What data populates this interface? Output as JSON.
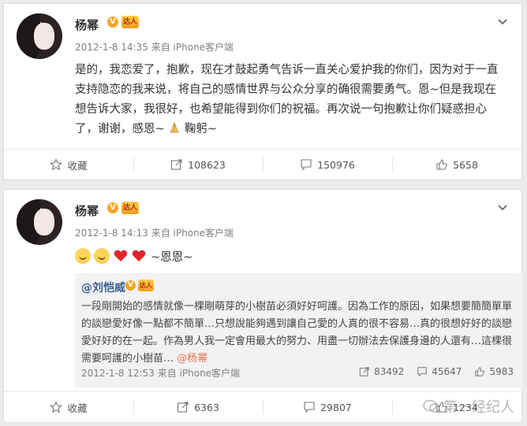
{
  "posts": [
    {
      "author": "杨幂",
      "v_badge": "V",
      "tag_badge": "达人",
      "time": "2012-1-8 14:35",
      "source_prefix": "来自",
      "source": "iPhone客户端",
      "text": "是的，我恋爱了，抱歉，现在才鼓起勇气告诉一直关心爱护我的你们，因为对于一直支持隐恋的我来说，将自己的感情世界与公众分享的确很需要勇气。恩~但是我现在想告诉大家，我很好，也希望能得到你们的祝福。再次说一句抱歉让你们疑惑担心了，谢谢，感恩~",
      "text_end": "鞠躬~",
      "toolbar": {
        "favorite": "收藏",
        "repost": "108623",
        "comment": "150976",
        "like": "5658"
      }
    },
    {
      "author": "杨幂",
      "v_badge": "V",
      "tag_badge": "达人",
      "time": "2012-1-8 14:13",
      "source_prefix": "来自",
      "source": "iPhone客户端",
      "emoji_text": "~恩恩~",
      "repost": {
        "author": "@刘恺威",
        "v_badge": "V",
        "tag_badge": "达人",
        "text": "一段剛開始的感情就像一棵剛萌芽的小樹苗必須好好呵護。因為工作的原因，如果想要簡簡單單的談戀愛好像一點都不簡單…只想說能夠遇到讓自己愛的人真的很不容易…真的很想好好的談戀愛好好的在一起。作為男人我一定會用最大的努力、用盡一切辦法去保護身邊的人還有…這棵很需要呵護的小樹苗…",
        "mention": "@杨幂",
        "time": "2012-1-8 12:53",
        "source_prefix": "来自",
        "source": "iPhone客户端",
        "reposts": "83492",
        "comments": "45647",
        "likes": "5983"
      },
      "toolbar": {
        "favorite": "收藏",
        "repost": "6363",
        "comment": "29807",
        "like": "1234"
      }
    }
  ],
  "watermark": "第一经纪人",
  "colors": {
    "link": "#3b5f8f",
    "mention": "#eb7350",
    "meta": "#808080",
    "badge": "#f6a623"
  }
}
